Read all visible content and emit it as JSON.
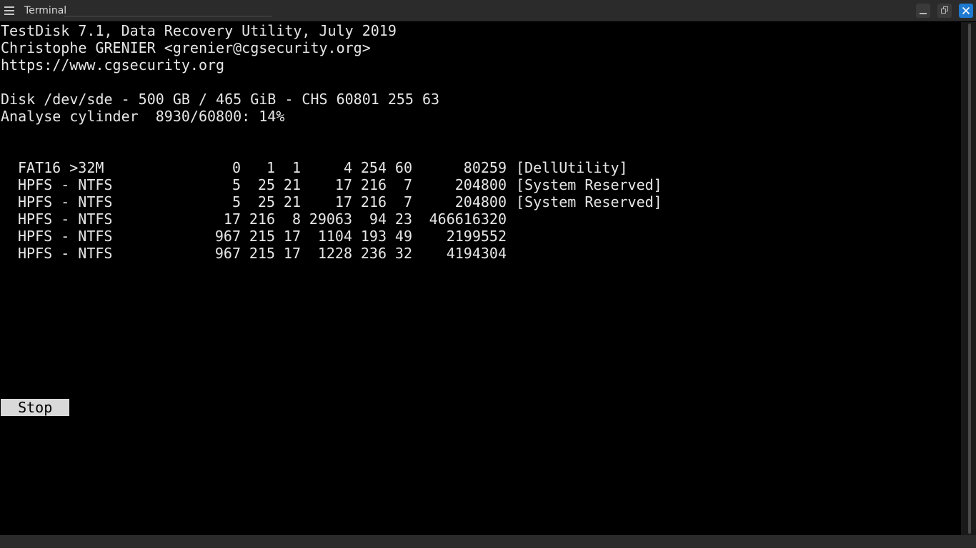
{
  "window": {
    "title": "Terminal"
  },
  "header": {
    "line1": "TestDisk 7.1, Data Recovery Utility, July 2019",
    "line2": "Christophe GRENIER <grenier@cgsecurity.org>",
    "line3": "https://www.cgsecurity.org"
  },
  "disk": {
    "info": "Disk /dev/sde - 500 GB / 465 GiB - CHS 60801 255 63",
    "progress": "Analyse cylinder  8930/60800: 14%"
  },
  "partitions": [
    {
      "type": "FAT16 >32M",
      "sc": "0",
      "sh": "1",
      "ss": "1",
      "ec": "4",
      "eh": "254",
      "es": "60",
      "size": "80259",
      "label": "[DellUtility]"
    },
    {
      "type": "HPFS - NTFS",
      "sc": "5",
      "sh": "25",
      "ss": "21",
      "ec": "17",
      "eh": "216",
      "es": "7",
      "size": "204800",
      "label": "[System Reserved]"
    },
    {
      "type": "HPFS - NTFS",
      "sc": "5",
      "sh": "25",
      "ss": "21",
      "ec": "17",
      "eh": "216",
      "es": "7",
      "size": "204800",
      "label": "[System Reserved]"
    },
    {
      "type": "HPFS - NTFS",
      "sc": "17",
      "sh": "216",
      "ss": "8",
      "ec": "29063",
      "eh": "94",
      "es": "23",
      "size": "466616320",
      "label": ""
    },
    {
      "type": "HPFS - NTFS",
      "sc": "967",
      "sh": "215",
      "ss": "17",
      "ec": "1104",
      "eh": "193",
      "es": "49",
      "size": "2199552",
      "label": ""
    },
    {
      "type": "HPFS - NTFS",
      "sc": "967",
      "sh": "215",
      "ss": "17",
      "ec": "1228",
      "eh": "236",
      "es": "32",
      "size": "4194304",
      "label": ""
    }
  ],
  "actions": {
    "stop_label": "  Stop  "
  },
  "icons": {
    "menu": "hamburger-menu-icon",
    "minimize": "minimize-icon",
    "maximize": "restore-icon",
    "close": "close-icon"
  },
  "colors": {
    "close_button": "#1e7ad0",
    "terminal_bg": "#000000",
    "terminal_fg": "#e6e6e6",
    "highlight_bg": "#d9d9d9"
  }
}
